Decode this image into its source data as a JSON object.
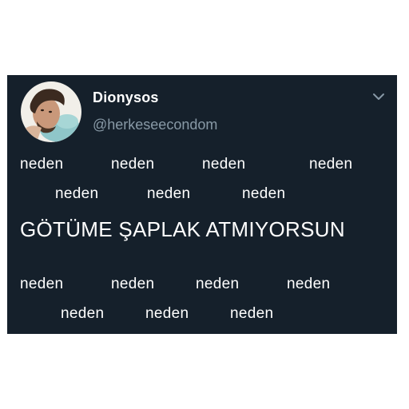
{
  "tweet": {
    "author": {
      "display_name": "Dionysos",
      "handle": "@herkeseecondom",
      "avatar_icon": "profile-photo"
    },
    "menu_icon": "chevron-down-icon",
    "lines": [
      [
        "neden",
        "neden",
        "neden",
        "neden"
      ],
      [
        "neden",
        "neden",
        "neden"
      ],
      [
        "GÖTÜME ŞAPLAK ATMIYORSUN"
      ],
      [
        "neden",
        "neden",
        "neden",
        "neden"
      ],
      [
        "neden",
        "neden",
        "neden"
      ]
    ]
  },
  "colors": {
    "background": "#15202b",
    "text": "#ffffff",
    "secondary_text": "#8899a6"
  }
}
